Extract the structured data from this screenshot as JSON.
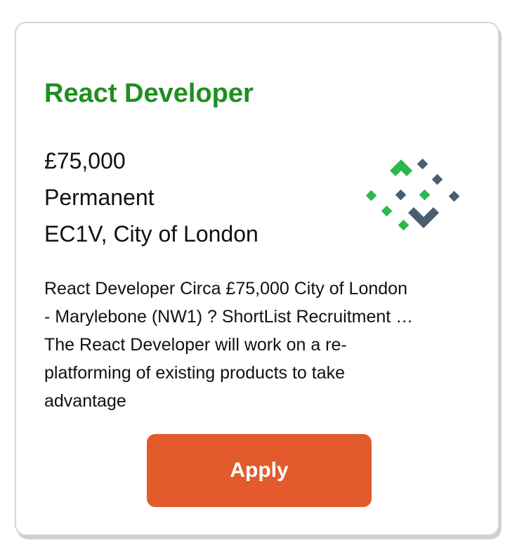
{
  "job": {
    "title": "React Developer",
    "salary": "£75,000",
    "type": "Permanent",
    "location": "EC1V, City of London",
    "description_lines": [
      "React Developer Circa £75,000 City of London",
      "- Marylebone (NW1) ? ShortList Recruitment …",
      "The React Developer will work on a re-",
      "platforming of existing products to take",
      "advantage"
    ]
  },
  "logo": {
    "icon": "recruiter-logo-icon",
    "colors": {
      "green": "#2db84d",
      "slate": "#4a5e70"
    }
  },
  "actions": {
    "apply_label": "Apply",
    "apply_color": "#e35b2c"
  },
  "theme": {
    "title_color": "#1f8f1f",
    "card_border": "#d6d6d6"
  }
}
